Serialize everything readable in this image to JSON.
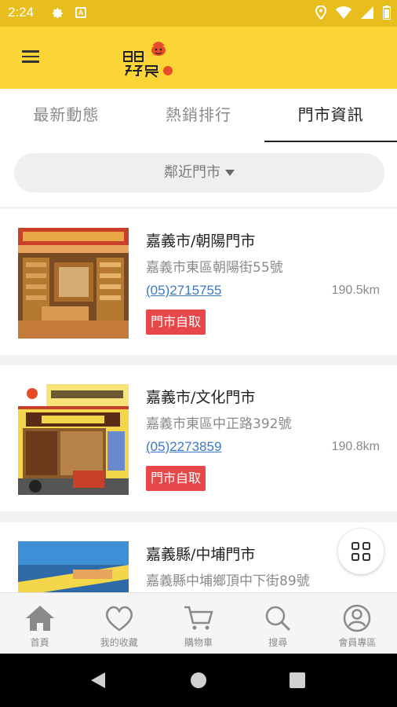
{
  "status_bar": {
    "time": "2:24",
    "icons": [
      "gear-icon",
      "a-notification-icon",
      "location-icon",
      "wifi-icon",
      "signal-icon",
      "battery-icon"
    ]
  },
  "app_bar": {
    "menu_icon": "hamburger-menu-icon",
    "logo_text": "日日好農"
  },
  "tabs": [
    {
      "label": "最新動態",
      "active": false
    },
    {
      "label": "熱銷排行",
      "active": false
    },
    {
      "label": "門市資訊",
      "active": true
    }
  ],
  "filter": {
    "label": "鄰近門市"
  },
  "stores": [
    {
      "name": "嘉義市/朝陽門市",
      "address": "嘉義市東區朝陽街55號",
      "phone": "(05)2715755",
      "distance": "190.5km",
      "badge": "門市自取"
    },
    {
      "name": "嘉義市/文化門市",
      "address": "嘉義市東區中正路392號",
      "phone": "(05)2273859",
      "distance": "190.8km",
      "badge": "門市自取"
    },
    {
      "name": "嘉義縣/中埔門市",
      "address": "嘉義縣中埔鄉頂中下街89號"
    }
  ],
  "bottom_nav": [
    {
      "label": "首頁",
      "icon": "home-icon"
    },
    {
      "label": "我的收藏",
      "icon": "heart-icon"
    },
    {
      "label": "購物車",
      "icon": "cart-icon"
    },
    {
      "label": "搜尋",
      "icon": "search-icon"
    },
    {
      "label": "會員專區",
      "icon": "user-icon"
    }
  ],
  "colors": {
    "brand_yellow": "#fbd436",
    "status_yellow": "#e8bd1e",
    "badge_red": "#e8474a",
    "link_blue": "#3b78c7"
  }
}
